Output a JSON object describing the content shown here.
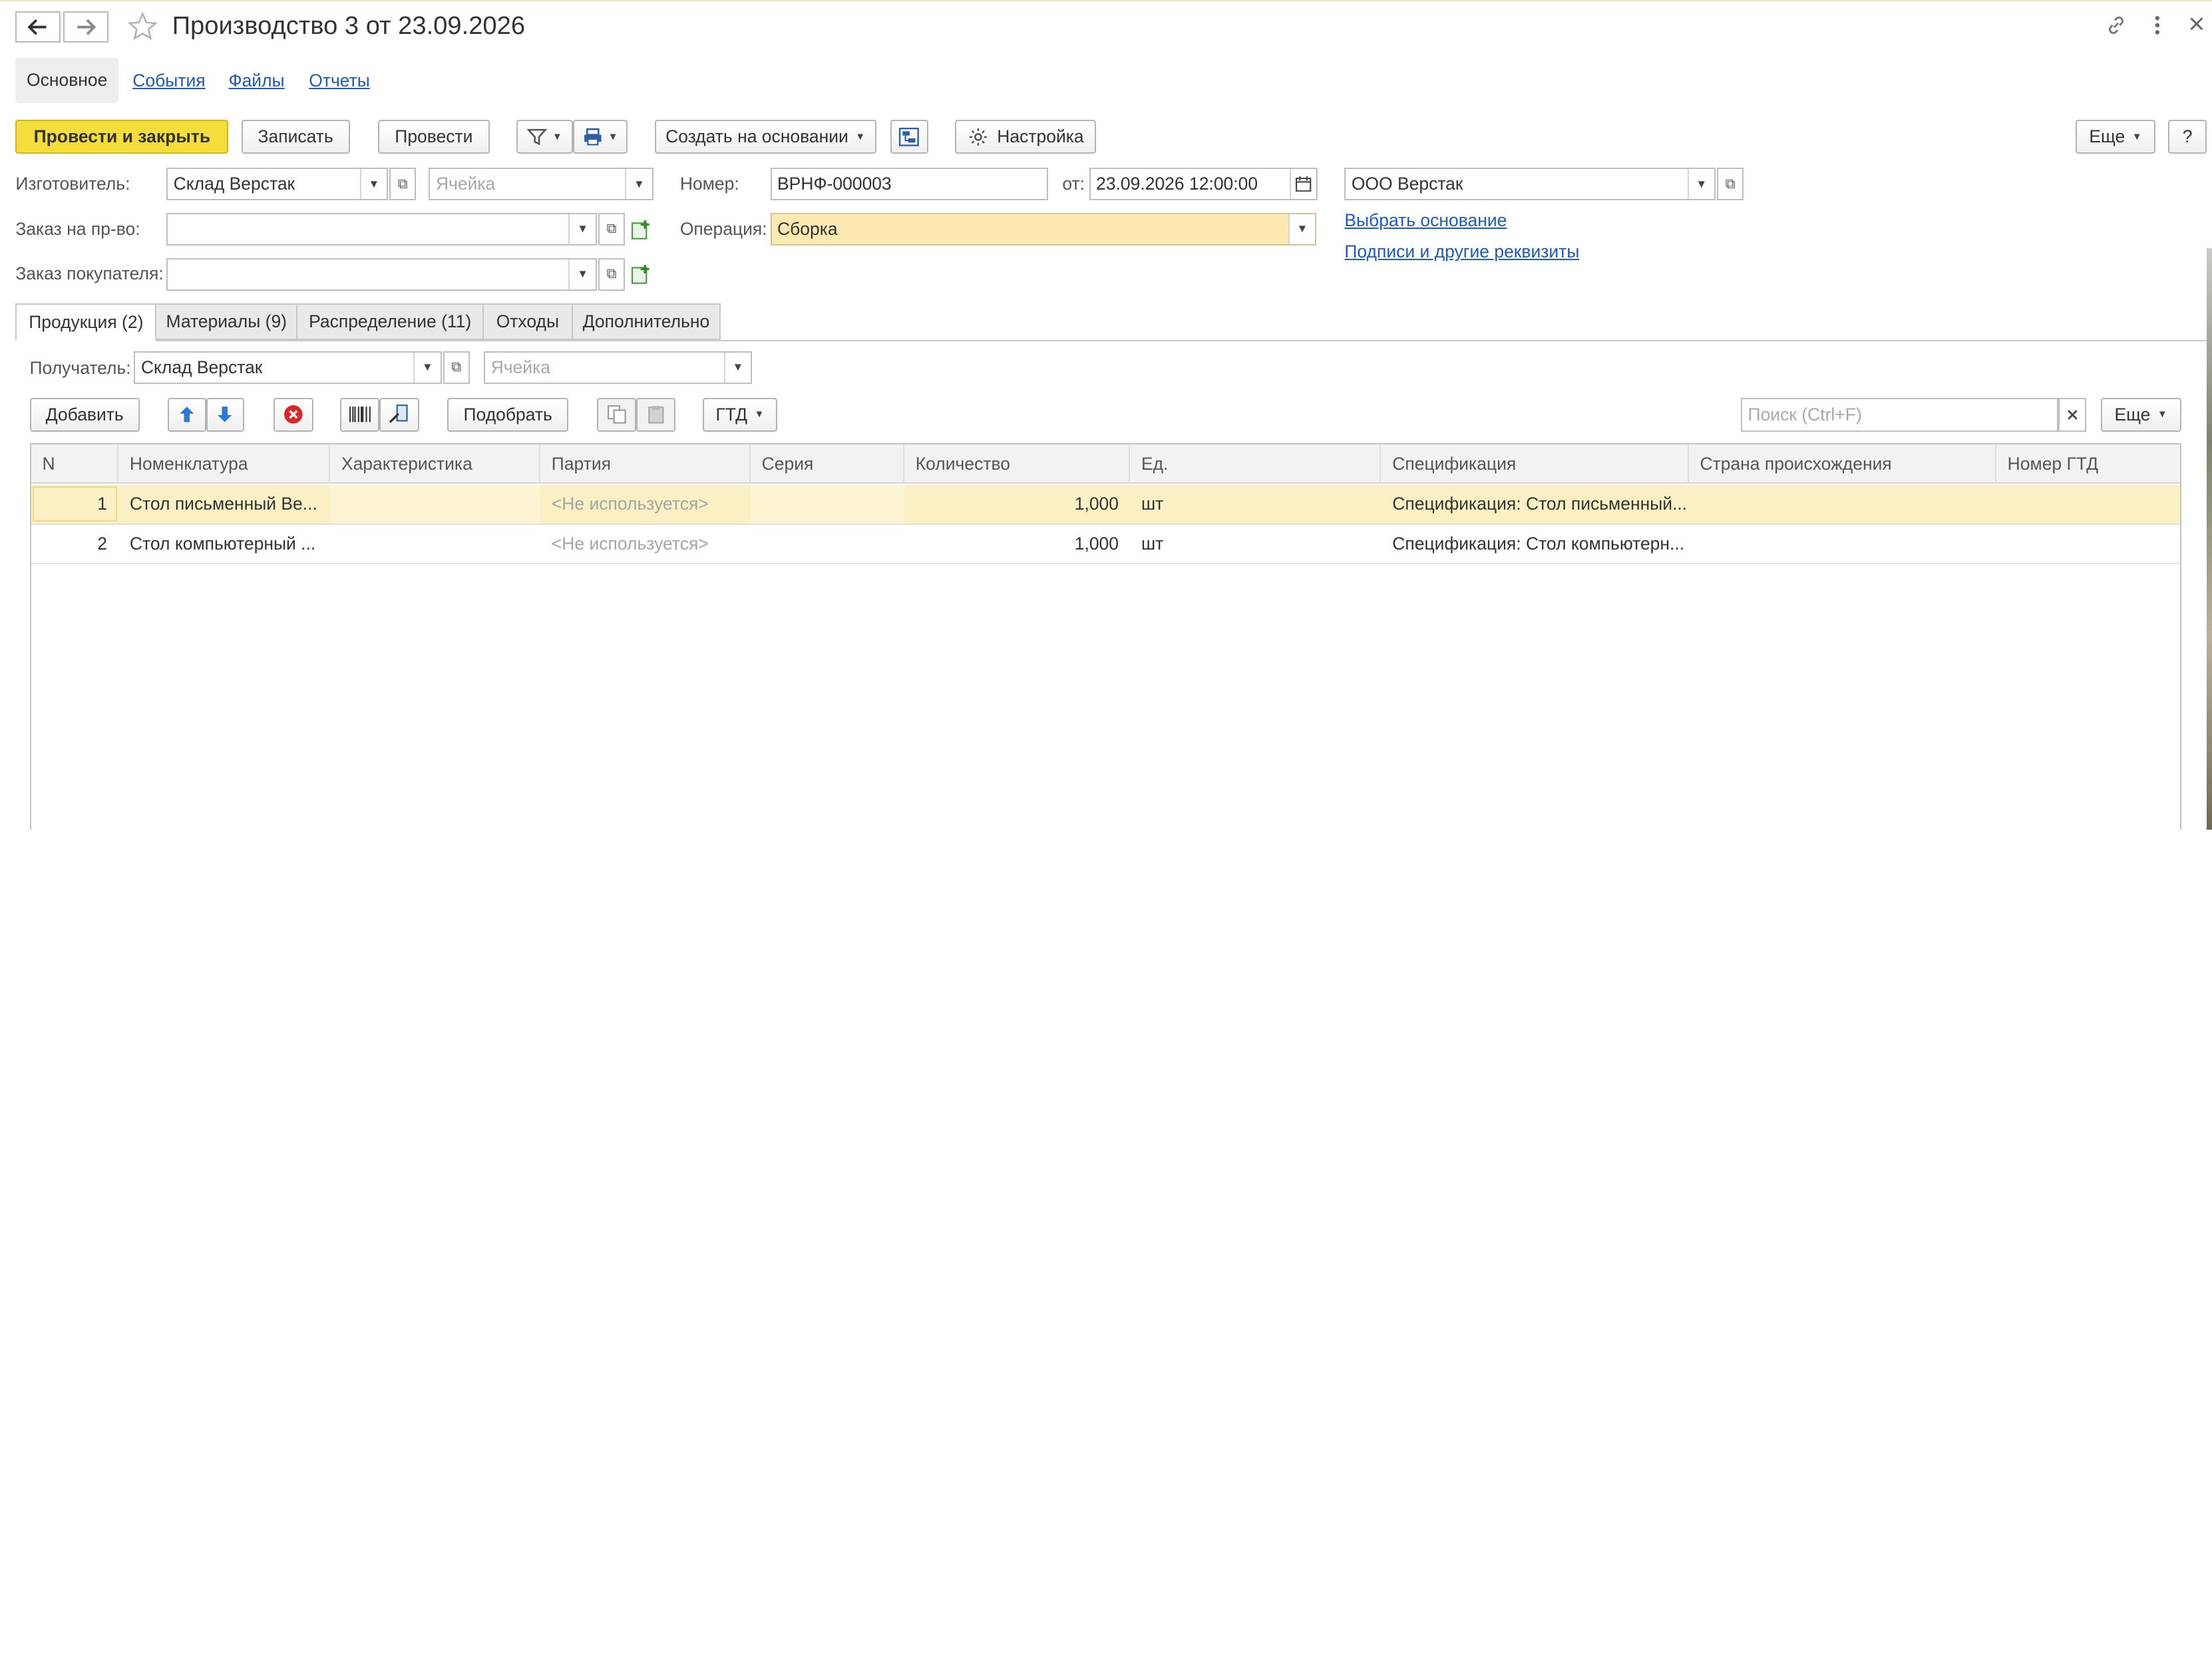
{
  "window": {
    "title": "Производство 3 от 23.09.2026",
    "back_icon": "arrow-left-icon",
    "forward_icon": "arrow-right-icon",
    "favorite_icon": "star-icon",
    "link_icon": "link-icon",
    "more_icon": "vertical-dots-icon",
    "close_icon": "close-icon"
  },
  "nav_tabs": [
    {
      "label": "Основное",
      "active": true
    },
    {
      "label": "События",
      "active": false
    },
    {
      "label": "Файлы",
      "active": false
    },
    {
      "label": "Отчеты",
      "active": false
    }
  ],
  "toolbar": {
    "post_close": "Провести и закрыть",
    "save": "Записать",
    "post": "Провести",
    "create_based": "Создать на основании",
    "settings": "Настройка",
    "more": "Еще",
    "help": "?"
  },
  "header": {
    "maker_label": "Изготовитель:",
    "maker_value": "Склад Верстак",
    "cell_placeholder": "Ячейка",
    "number_label": "Номер:",
    "number_value": "ВРНФ-000003",
    "date_label": "от:",
    "date_value": "23.09.2026 12:00:00",
    "org_value": "ООО Верстак",
    "order_label": "Заказ на пр-во:",
    "order_value": "",
    "operation_label": "Операция:",
    "operation_value": "Сборка",
    "client_order_label": "Заказ покупателя:",
    "client_order_value": "",
    "choose_basis_link": "Выбрать основание",
    "signatures_link": "Подписи и другие реквизиты"
  },
  "page_tabs": [
    {
      "label": "Продукция (2)",
      "active": true
    },
    {
      "label": "Материалы (9)",
      "active": false
    },
    {
      "label": "Распределение (11)",
      "active": false
    },
    {
      "label": "Отходы",
      "active": false
    },
    {
      "label": "Дополнительно",
      "active": false
    }
  ],
  "products": {
    "recipient_label": "Получатель:",
    "recipient_value": "Склад Верстак",
    "cell_placeholder": "Ячейка",
    "add_button": "Добавить",
    "pick_button": "Подобрать",
    "gtd_button": "ГТД",
    "search_placeholder": "Поиск (Ctrl+F)",
    "more": "Еще"
  },
  "table": {
    "columns": [
      "N",
      "Номенклатура",
      "Характеристика",
      "Партия",
      "Серия",
      "Количество",
      "Ед.",
      "Спецификация",
      "Страна происхождения",
      "Номер ГТД"
    ],
    "rows": [
      {
        "n": "1",
        "item": "Стол письменный Ве...",
        "characteristic": "",
        "batch": "<Не используется>",
        "series": "",
        "qty": "1,000",
        "unit": "шт",
        "spec": "Спецификация: Стол письменный...",
        "country": "",
        "gtd": "",
        "selected": true
      },
      {
        "n": "2",
        "item": "Стол компьютерный ...",
        "characteristic": "",
        "batch": "<Не используется>",
        "series": "",
        "qty": "1,000",
        "unit": "шт",
        "spec": "Спецификация: Стол компьютерн...",
        "country": "",
        "gtd": "",
        "selected": false
      }
    ]
  },
  "colors": {
    "primary_button": "#f5dd3c",
    "link": "#1f5bb3",
    "selected_row": "#fbf0c4",
    "operation_field": "#fde9b2"
  }
}
